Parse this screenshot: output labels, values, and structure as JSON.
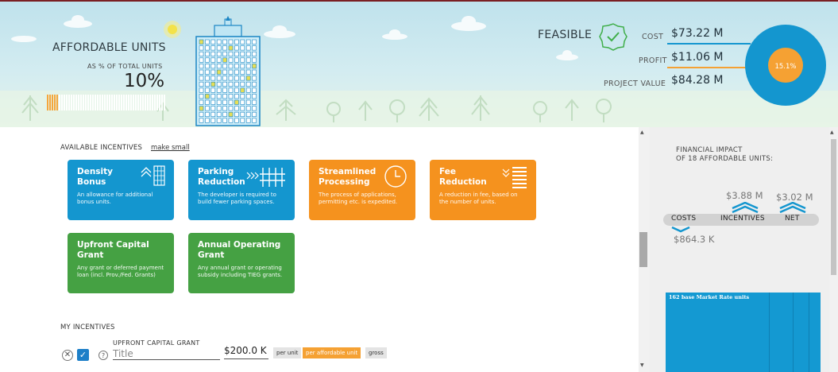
{
  "header": {
    "affordable_title": "AFFORDABLE UNITS",
    "affordable_subtitle": "AS % OF TOTAL UNITS",
    "affordable_percent": "10%",
    "affordable_fraction": 0.1,
    "feasible_label": "FEASIBLE",
    "cost_label": "COST",
    "cost_value": "$73.22 M",
    "profit_label": "PROFIT",
    "profit_value": "$11.06 M",
    "project_value_label": "PROJECT VALUE",
    "project_value": "$84.28 M",
    "pie_label": "15.1%",
    "pie_fraction": 0.151,
    "colors": {
      "cost": "#1496cf",
      "profit": "#f5a133",
      "feasible": "#3fae49"
    }
  },
  "incentives": {
    "heading": "AVAILABLE INCENTIVES",
    "make_small": "make small",
    "cards": [
      {
        "title": "Density Bonus",
        "desc": "An allowance for additional bonus units.",
        "icon": "building-arrows-icon",
        "color": "#1496cf"
      },
      {
        "title": "Parking Reduction",
        "desc": "The developer is required to build fewer parking spaces.",
        "icon": "parking-fence-icon",
        "color": "#1496cf"
      },
      {
        "title": "Streamlined Processing",
        "desc": "The process of applications, permitting etc. is expedited.",
        "icon": "clock-icon",
        "color": "#f5921e"
      },
      {
        "title": "Fee Reduction",
        "desc": "A reduction in fee, based on the number of units.",
        "icon": "stacked-bills-icon",
        "color": "#f5921e"
      },
      {
        "title": "Upfront Capital Grant",
        "desc": "Any grant or deferred payment loan (incl. Prov./Fed. Grants)",
        "icon": "",
        "color": "#45a143"
      },
      {
        "title": "Annual Operating Grant",
        "desc": "Any annual grant or operating subsidy including TIEG grants.",
        "icon": "",
        "color": "#45a143"
      }
    ]
  },
  "my_incentives": {
    "heading": "MY INCENTIVES",
    "item_caption": "UPFRONT CAPITAL GRANT",
    "title_placeholder": "Title",
    "amount": "$200.0 K",
    "options": [
      "per unit",
      "per affordable unit",
      "gross"
    ],
    "selected_option": "per affordable unit",
    "checked": true
  },
  "financial_impact": {
    "title_line1": "FINANCIAL IMPACT",
    "title_line2": "OF 18 AFFORDABLE UNITS:",
    "labels": [
      "COSTS",
      "INCENTIVES",
      "NET"
    ],
    "incentives_value": "$3.88 M",
    "net_value": "$3.02 M",
    "costs_value": "$864.3 K",
    "market_label": "162 base Market Rate units"
  }
}
